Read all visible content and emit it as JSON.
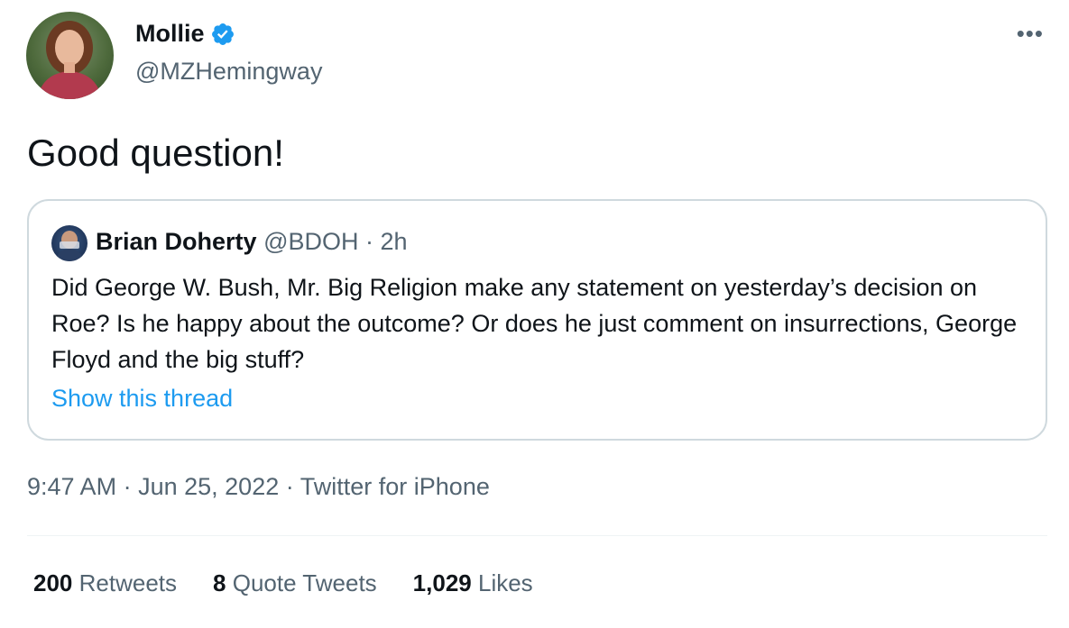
{
  "author": {
    "display_name": "Mollie",
    "handle": "@MZHemingway",
    "verified": true
  },
  "more_label": "•••",
  "tweet_text": "Good question!",
  "quoted_tweet": {
    "author_name": "Brian Doherty",
    "author_handle": "@BDOH",
    "separator": "·",
    "age": "2h",
    "text": "Did George W. Bush, Mr. Big Religion make any statement on yesterday’s decision on Roe? Is he happy about the outcome? Or does he just comment on insurrections, George Floyd and the big stuff?",
    "show_thread_label": "Show this thread"
  },
  "meta": {
    "time": "9:47 AM",
    "separator": "·",
    "date": "Jun 25, 2022",
    "source": "Twitter for iPhone"
  },
  "stats": [
    {
      "count": "200",
      "label": "Retweets"
    },
    {
      "count": "8",
      "label": "Quote Tweets"
    },
    {
      "count": "1,029",
      "label": "Likes"
    }
  ],
  "colors": {
    "link_blue": "#1d9bf0",
    "secondary_text": "#536471",
    "border": "#cfd9de"
  }
}
